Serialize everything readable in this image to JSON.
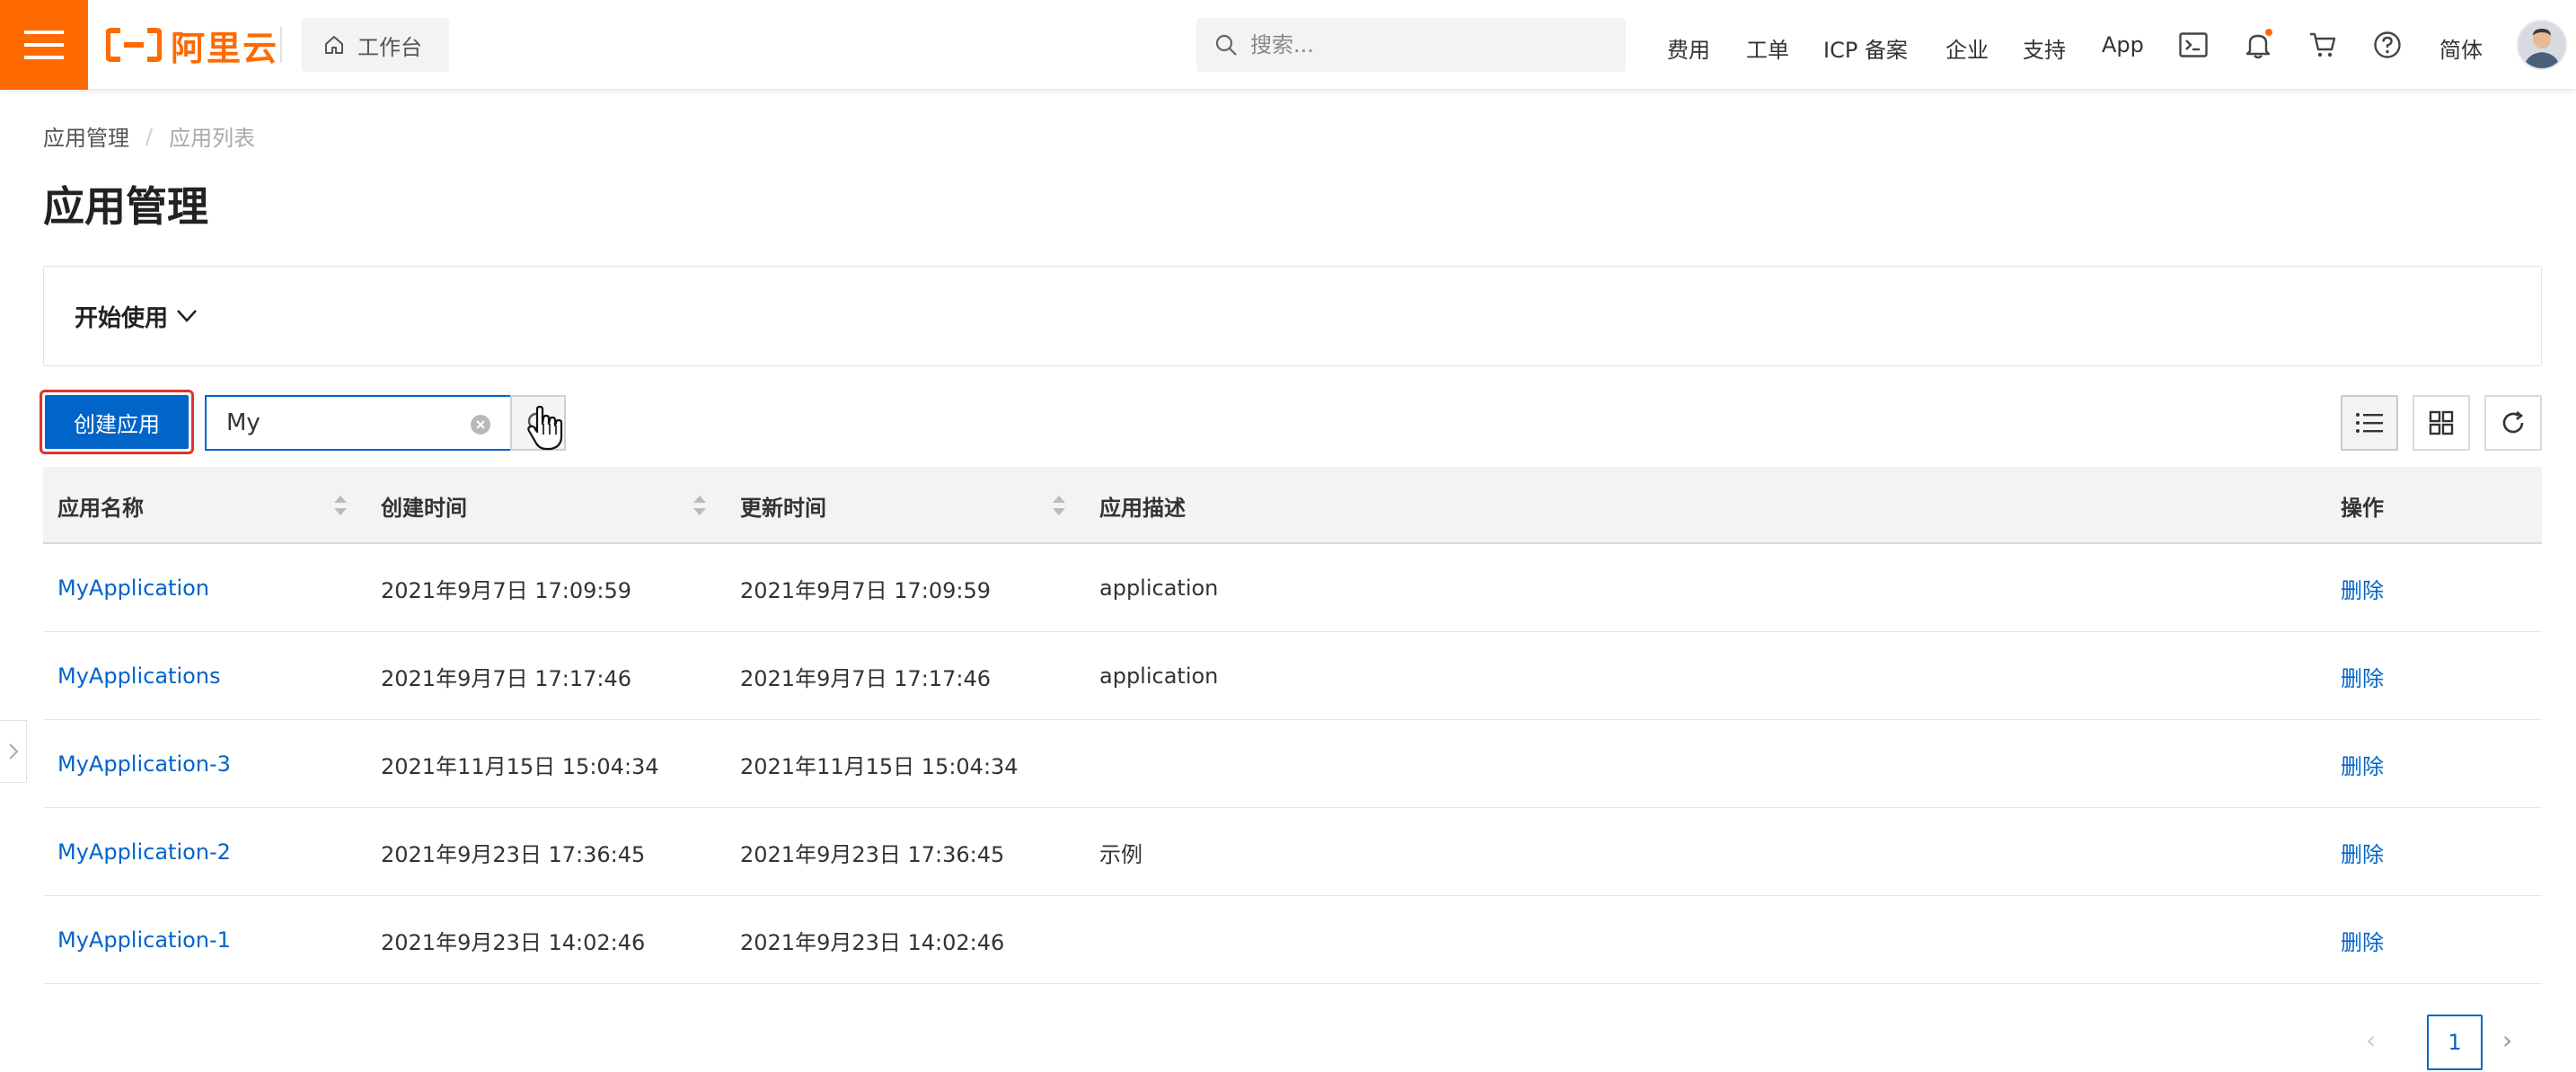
{
  "header": {
    "logo_text": "阿里云",
    "workbench_label": "工作台",
    "search_placeholder": "搜索...",
    "nav_links": [
      "费用",
      "工单",
      "ICP 备案",
      "企业",
      "支持",
      "App"
    ],
    "language": "简体",
    "icons": [
      "terminal-icon",
      "bell-icon",
      "cart-icon",
      "help-icon"
    ]
  },
  "breadcrumb": {
    "parent": "应用管理",
    "separator": "/",
    "current": "应用列表"
  },
  "page": {
    "title": "应用管理"
  },
  "getting_started": {
    "label": "开始使用"
  },
  "toolbar": {
    "create_label": "创建应用",
    "filter_value": "My"
  },
  "table": {
    "columns": [
      "应用名称",
      "创建时间",
      "更新时间",
      "应用描述",
      "操作"
    ],
    "rows": [
      {
        "name": "MyApplication",
        "created": "2021年9月7日 17:09:59",
        "updated": "2021年9月7日 17:09:59",
        "desc": "application",
        "action": "删除"
      },
      {
        "name": "MyApplications",
        "created": "2021年9月7日 17:17:46",
        "updated": "2021年9月7日 17:17:46",
        "desc": "application",
        "action": "删除"
      },
      {
        "name": "MyApplication-3",
        "created": "2021年11月15日 15:04:34",
        "updated": "2021年11月15日 15:04:34",
        "desc": "",
        "action": "删除"
      },
      {
        "name": "MyApplication-2",
        "created": "2021年9月23日 17:36:45",
        "updated": "2021年9月23日 17:36:45",
        "desc": "示例",
        "action": "删除"
      },
      {
        "name": "MyApplication-1",
        "created": "2021年9月23日 14:02:46",
        "updated": "2021年9月23日 14:02:46",
        "desc": "",
        "action": "删除"
      }
    ]
  },
  "pagination": {
    "current_page": "1",
    "prev": "‹",
    "next": "›"
  },
  "colors": {
    "brand": "#ff6a00",
    "primary": "#0064c8",
    "highlight": "#e0322d"
  }
}
